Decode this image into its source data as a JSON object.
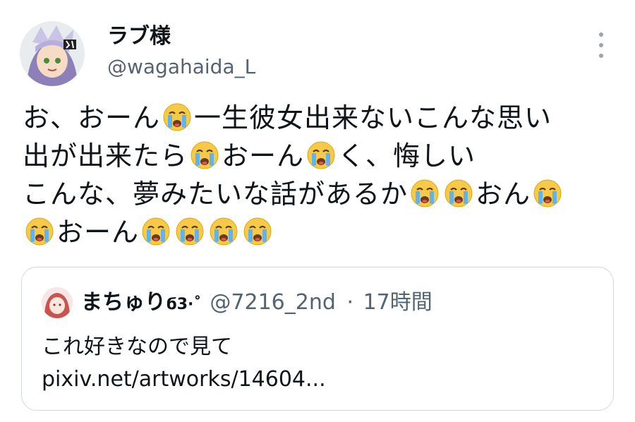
{
  "author": {
    "display_name": "ラブ様",
    "handle": "@wagahaida_L",
    "avatar_icon": "avatar-anime-character-icon"
  },
  "menu_icon": "more-vertical-icon",
  "tweet": {
    "lines": [
      {
        "parts": [
          "お、おーん",
          "😭",
          "一生彼女出来ないこんな思い"
        ]
      },
      {
        "parts": [
          "出が出来たら",
          "😭",
          "おーん",
          "😭",
          "く、悔しい"
        ]
      },
      {
        "parts": [
          "こんな、夢みたいな話があるか",
          "😭",
          "😭",
          "おん",
          "😭"
        ]
      },
      {
        "parts": [
          "😭",
          "おーん",
          "😭",
          "😭",
          "😭",
          "😭"
        ]
      }
    ],
    "emoji": "😭"
  },
  "quoted_tweet": {
    "display_name": "まちゅり",
    "name_decoration": "ϭ3·˚",
    "handle": "@7216_2nd",
    "separator": "·",
    "time": "17時間",
    "text": "これ好きなので見て",
    "link": "pixiv.net/artworks/14604..."
  },
  "colors": {
    "text": "#0f1419",
    "secondary": "#536471",
    "border": "#cfd9de"
  }
}
